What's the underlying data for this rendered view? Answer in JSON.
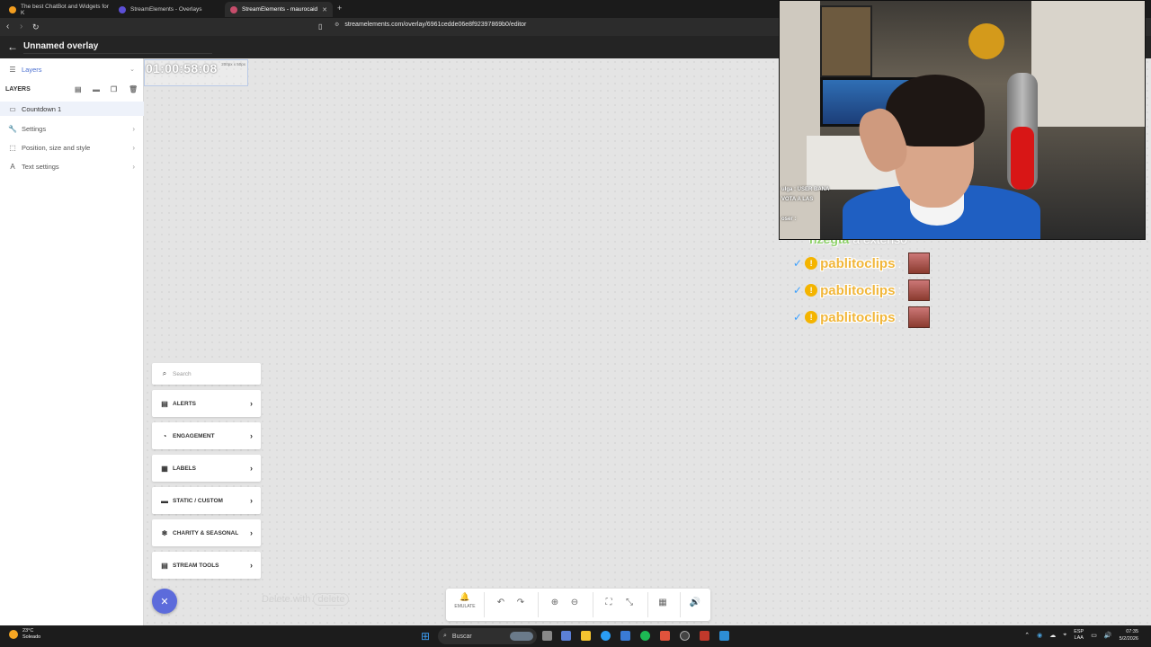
{
  "browser": {
    "tabs": [
      {
        "title": "The best ChatBot and Widgets for K",
        "fav_color": "#f29d1f",
        "active": false
      },
      {
        "title": "StreamElements - Overlays",
        "fav_color": "#5c4fd6",
        "active": false
      },
      {
        "title": "StreamElements - maurocaid",
        "fav_color": "#c74d6b",
        "active": true
      }
    ],
    "new_tab": "+",
    "url": "streamelements.com/overlay/6961cedde06e8f92397869b0/editor"
  },
  "editor": {
    "title": "Unnamed overlay"
  },
  "sidebar": {
    "dropdown_label": "Layers",
    "section_title": "LAYERS",
    "layer_item": "Countdown 1",
    "settings_items": [
      {
        "label": "Settings",
        "icon": "wrench-icon"
      },
      {
        "label": "Position, size and style",
        "icon": "position-icon"
      },
      {
        "label": "Text settings",
        "icon": "text-icon"
      }
    ]
  },
  "canvas": {
    "countdown_time": "01:00:58:08",
    "countdown_dims": "200px x 50px",
    "delete_hint_prefix": "Delete with",
    "delete_hint_key": "delete"
  },
  "widget_menu": {
    "search_placeholder": "Search",
    "categories": [
      {
        "label": "ALERTS",
        "icon": "alerts-icon"
      },
      {
        "label": "ENGAGEMENT",
        "icon": "engagement-icon"
      },
      {
        "label": "LABELS",
        "icon": "labels-icon"
      },
      {
        "label": "STATIC / CUSTOM",
        "icon": "static-icon"
      },
      {
        "label": "CHARITY & SEASONAL",
        "icon": "charity-icon"
      },
      {
        "label": "STREAM TOOLS",
        "icon": "stream-tools-icon"
      }
    ]
  },
  "toolbar": {
    "emulate_label": "EMULATE"
  },
  "chat_overlay": {
    "partial_name": "nzegta",
    "partial_text": "a extenso",
    "lines": [
      {
        "name": "pablitoclips"
      },
      {
        "name": "pablitoclips"
      },
      {
        "name": "pablitoclips"
      }
    ]
  },
  "webcam": {
    "chat_lines": [
      "ulga : USER BANA",
      "VOTA A LAS",
      "oser :"
    ]
  },
  "taskbar": {
    "weather_temp": "23°C",
    "weather_desc": "Soleado",
    "search_label": "Buscar",
    "lang_top": "ESP",
    "lang_bottom": "LAA",
    "time": "07:35",
    "date": "5/2/2026"
  }
}
